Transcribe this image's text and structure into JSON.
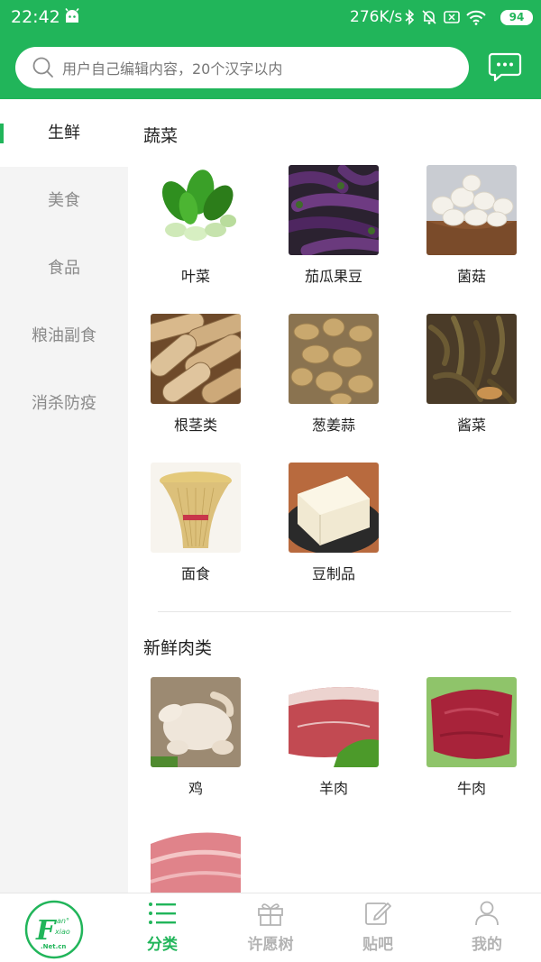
{
  "status_bar": {
    "time": "22:42",
    "net_speed": "276K/s",
    "battery": "94",
    "icons": [
      "android-icon",
      "bluetooth-icon",
      "mute-icon",
      "sim-icon",
      "wifi-icon",
      "battery-icon"
    ]
  },
  "search": {
    "placeholder": "用户自己编辑内容，20个汉字以内"
  },
  "theme": {
    "accent": "#21b55a",
    "sidebar_bg": "#f4f4f4",
    "muted_text": "#8a8a8a"
  },
  "sidebar": {
    "items": [
      {
        "label": "生鲜",
        "active": true
      },
      {
        "label": "美食",
        "active": false
      },
      {
        "label": "食品",
        "active": false
      },
      {
        "label": "粮油副食",
        "active": false
      },
      {
        "label": "消杀防疫",
        "active": false
      }
    ]
  },
  "sections": [
    {
      "title": "蔬菜",
      "items": [
        {
          "label": "叶菜",
          "image": "leafy-greens"
        },
        {
          "label": "茄瓜果豆",
          "image": "eggplants"
        },
        {
          "label": "菌菇",
          "image": "mushrooms"
        },
        {
          "label": "根茎类",
          "image": "lotus-roots"
        },
        {
          "label": "葱姜蒜",
          "image": "ginger"
        },
        {
          "label": "酱菜",
          "image": "pickled-vegetables"
        },
        {
          "label": "面食",
          "image": "noodles"
        },
        {
          "label": "豆制品",
          "image": "tofu"
        }
      ]
    },
    {
      "title": "新鲜肉类",
      "items": [
        {
          "label": "鸡",
          "image": "whole-chicken"
        },
        {
          "label": "羊肉",
          "image": "mutton"
        },
        {
          "label": "牛肉",
          "image": "beef"
        },
        {
          "label": "",
          "image": "pork-slices"
        }
      ]
    }
  ],
  "tabbar": {
    "logo": "fanxiao-net-logo",
    "tabs": [
      {
        "label": "分类",
        "icon": "list-icon",
        "active": true
      },
      {
        "label": "许愿树",
        "icon": "gift-icon",
        "active": false
      },
      {
        "label": "贴吧",
        "icon": "edit-icon",
        "active": false
      },
      {
        "label": "我的",
        "icon": "person-icon",
        "active": false
      }
    ]
  }
}
